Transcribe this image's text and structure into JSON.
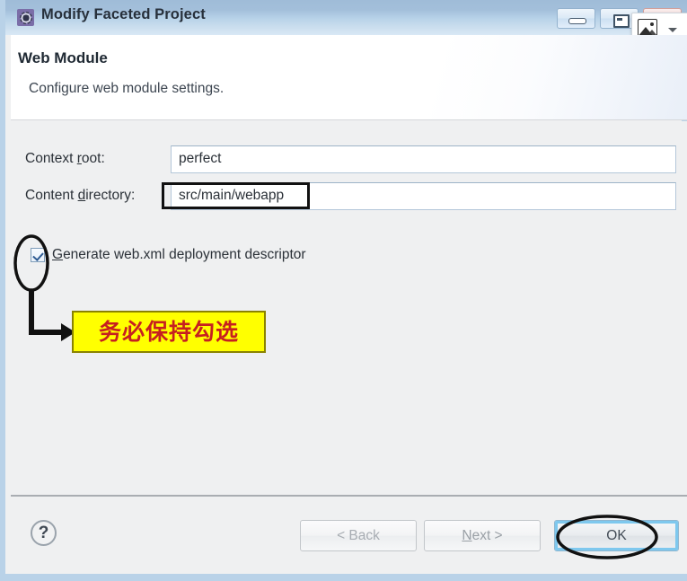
{
  "window": {
    "title": "Modify Faceted Project",
    "icon": "faceted-project-icon",
    "caption_buttons": [
      {
        "name": "minimize",
        "glyph": "minimize-icon"
      },
      {
        "name": "maximize",
        "glyph": "maximize-icon"
      },
      {
        "name": "close",
        "glyph": "close-icon"
      }
    ]
  },
  "capture_overlay": {
    "image_icon": "image-capture-icon",
    "caret_icon": "chevron-down-icon"
  },
  "header": {
    "title": "Web Module",
    "subtitle": "Configure web module settings."
  },
  "form": {
    "context_root": {
      "label_before": "Context ",
      "label_mnemonic": "r",
      "label_after": "oot:",
      "value": "perfect",
      "placeholder": ""
    },
    "content_directory": {
      "label_before": "Content ",
      "label_mnemonic": "d",
      "label_after": "irectory:",
      "value": "src/main/webapp",
      "placeholder": ""
    },
    "generate_webxml": {
      "label_before": "",
      "label_mnemonic": "G",
      "label_after": "enerate web.xml deployment descriptor",
      "checked": true
    }
  },
  "footer": {
    "help_label": "?",
    "back": {
      "label": "< Back",
      "enabled": false
    },
    "next": {
      "label_before": "",
      "label_mnemonic": "N",
      "label_after": "ext >",
      "enabled": false
    },
    "ok": {
      "label": "OK",
      "focused": true
    }
  },
  "annotations": {
    "note_text": "务必保持勾选",
    "note_bg_color": "#ffff00",
    "note_border_color": "#8a8200",
    "note_text_color": "#c62020",
    "highlight_color": "#111111",
    "ellipse_checkbox": "circles the Generate web.xml checkbox",
    "ellipse_ok": "circles the OK button",
    "rect_content_directory": "highlights the src/main/webapp value",
    "arrow": "elbow arrow from checkbox ellipse to note box"
  },
  "colors": {
    "titlebar_top": "#9fbcd8",
    "titlebar_bottom": "#d9e8f5",
    "window_border": "#b9d2e8",
    "panel_bg": "#eff0f1",
    "header_bg": "#ffffff",
    "focus_ring": "#7ec8ee"
  }
}
